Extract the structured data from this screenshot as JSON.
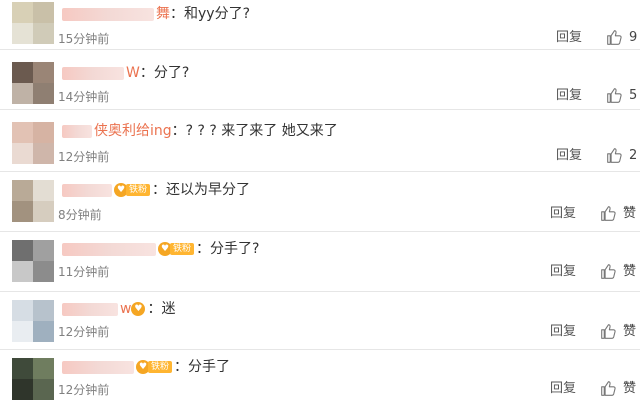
{
  "comments": [
    {
      "name_tail": "舞",
      "badge": false,
      "badge_label": "",
      "text": "和yy分了?",
      "time": "15分钟前",
      "reply": "回复",
      "likes": "9",
      "avatar": [
        "#d8d0b6",
        "#c9c0a8",
        "#e5e2d5",
        "#d0cbb8"
      ]
    },
    {
      "name_tail": "W",
      "badge": false,
      "badge_label": "",
      "text": "分了?",
      "time": "14分钟前",
      "reply": "回复",
      "likes": "5",
      "avatar": [
        "#6b5a4f",
        "#9a8576",
        "#bfb2a6",
        "#8f7f72"
      ]
    },
    {
      "name_tail": "侠奥利给ing",
      "badge": false,
      "badge_label": "",
      "text": "? ? ? 来了来了 她又来了",
      "time": "12分钟前",
      "reply": "回复",
      "likes": "2",
      "avatar": [
        "#e2c2b4",
        "#d6b3a3",
        "#eadad2",
        "#cfb6aa"
      ]
    },
    {
      "name_tail": "",
      "badge": true,
      "badge_label": "铁粉",
      "text": "还以为早分了",
      "time": "8分钟前",
      "reply": "回复",
      "likes": "赞",
      "avatar": [
        "#b9aa97",
        "#e3ddd3",
        "#a2927f",
        "#d6cdbf"
      ]
    },
    {
      "name_tail": "",
      "badge": true,
      "badge_label": "铁粉",
      "text": "分手了?",
      "time": "11分钟前",
      "reply": "回复",
      "likes": "赞",
      "avatar": [
        "#6f6f6f",
        "#a0a0a0",
        "#c8c8c8",
        "#8c8c8c"
      ]
    },
    {
      "name_tail": "w",
      "badge": true,
      "badge_label": "",
      "text": "迷",
      "time": "12分钟前",
      "reply": "回复",
      "likes": "赞",
      "avatar": [
        "#d6dde4",
        "#b7c2cc",
        "#e9edf1",
        "#9fb0bf"
      ]
    },
    {
      "name_tail": "",
      "badge": true,
      "badge_label": "铁粉",
      "text": "分手了",
      "time": "12分钟前",
      "reply": "回复",
      "likes": "赞",
      "avatar": [
        "#3f4a3a",
        "#6f7d5f",
        "#2f352b",
        "#5a6650"
      ]
    }
  ],
  "icons": {
    "like": "thumbs-up-icon"
  }
}
